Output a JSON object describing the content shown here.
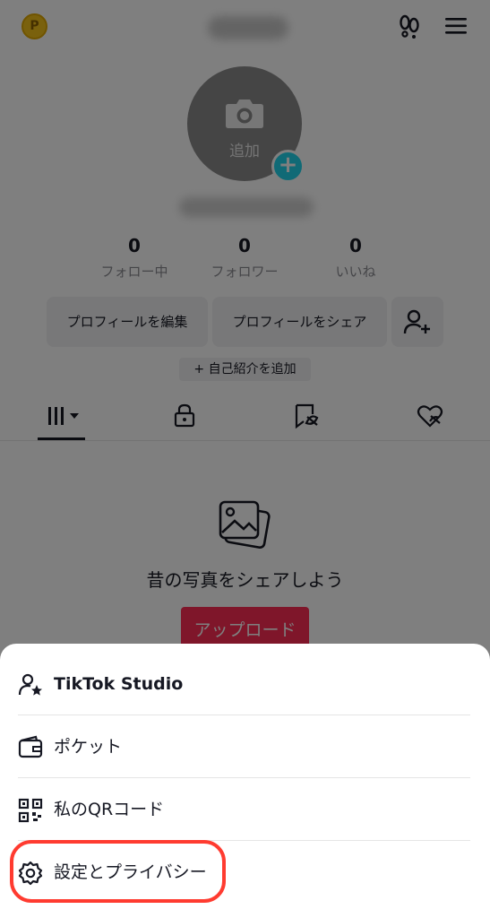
{
  "header": {
    "coin_glyph": "P",
    "icons": [
      "coin-icon",
      "footprints-icon",
      "menu-icon"
    ]
  },
  "avatar": {
    "add_label": "追加",
    "plus_glyph": "+"
  },
  "stats": [
    {
      "value": "0",
      "label": "フォロー中"
    },
    {
      "value": "0",
      "label": "フォロワー"
    },
    {
      "value": "0",
      "label": "いいね"
    }
  ],
  "buttons": {
    "edit_profile": "プロフィールを編集",
    "share_profile": "プロフィールをシェア",
    "add_bio": "+ 自己紹介を追加"
  },
  "tabs": [
    "videos-grid-icon",
    "lock-icon",
    "repost-icon",
    "liked-icon"
  ],
  "empty_state": {
    "message": "昔の写真をシェアしよう",
    "upload_label": "アップロード"
  },
  "sheet": {
    "items": [
      {
        "label": "TikTok Studio",
        "icon": "creator-star-icon"
      },
      {
        "label": "ポケット",
        "icon": "wallet-icon"
      },
      {
        "label": "私のQRコード",
        "icon": "qr-code-icon"
      },
      {
        "label": "設定とプライバシー",
        "icon": "gear-icon"
      }
    ]
  },
  "colors": {
    "accent_red": "#fe2c55",
    "highlight": "#ff3b30",
    "plus_cyan": "#20d5ec",
    "overlay": "rgba(0,0,0,0.5)"
  }
}
